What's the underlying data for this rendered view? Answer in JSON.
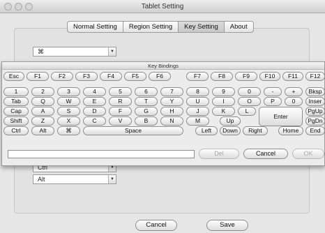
{
  "window": {
    "title": "Tablet Setting"
  },
  "tabs": [
    {
      "label": "Normal Setting"
    },
    {
      "label": "Region Setting"
    },
    {
      "label": "Key Setting"
    },
    {
      "label": "About"
    }
  ],
  "combos": [
    {
      "value": "⌘"
    },
    {
      "value": "Ctrl"
    },
    {
      "value": "Alt"
    }
  ],
  "key_bindings": {
    "title": "Key Bindings",
    "rows": [
      [
        "Esc",
        "F1",
        "F2",
        "F3",
        "F4",
        "F5",
        "F6",
        "F7",
        "F8",
        "F9",
        "F10",
        "F11",
        "F12"
      ],
      [
        "1",
        "2",
        "3",
        "4",
        "5",
        "6",
        "7",
        "8",
        "9",
        "0",
        "-",
        "+",
        "Bksp"
      ],
      [
        "Tab",
        "Q",
        "W",
        "E",
        "R",
        "T",
        "Y",
        "U",
        "I",
        "O",
        "P",
        "0",
        "Inser"
      ],
      [
        "Cap",
        "A",
        "S",
        "D",
        "F",
        "G",
        "H",
        "J",
        "K",
        "L",
        "Enter",
        "PgUp"
      ],
      [
        "Shift",
        "Z",
        "X",
        "C",
        "V",
        "B",
        "N",
        "M",
        "Up",
        "PgDn"
      ],
      [
        "Ctrl",
        "Alt",
        "⌘",
        "Space",
        "Left",
        "Down",
        "Right",
        "Home",
        "End"
      ]
    ],
    "input_value": "",
    "del_label": "Del",
    "cancel_label": "Cancel",
    "ok_label": "OK"
  },
  "footer": {
    "cancel_label": "Cancel",
    "save_label": "Save"
  }
}
